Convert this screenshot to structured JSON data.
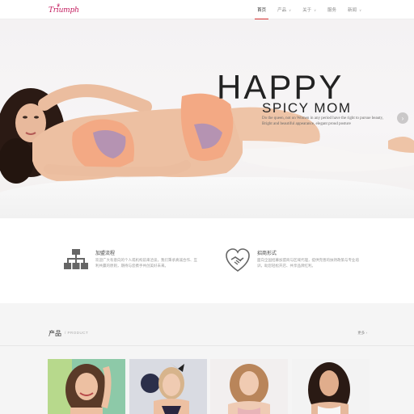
{
  "brand": {
    "logo_text": "Triumph"
  },
  "nav": {
    "items": [
      {
        "label": "首页",
        "active": true,
        "dropdown": false
      },
      {
        "label": "产品",
        "active": false,
        "dropdown": true
      },
      {
        "label": "关于",
        "active": false,
        "dropdown": true
      },
      {
        "label": "服务",
        "active": false,
        "dropdown": false
      },
      {
        "label": "新闻",
        "active": false,
        "dropdown": true
      }
    ]
  },
  "hero": {
    "title": "HAPPY",
    "subtitle": "SPICY MOM",
    "desc_line1": "Do the queen, not on Women in any period have the right to pursue beauty,",
    "desc_line2": "Bright and beautiful appearance, elegant proud posture",
    "next_icon": "chevron-right-icon"
  },
  "features": [
    {
      "icon": "org-chart-icon",
      "title": "加盟流程",
      "text": "欢迎广大有意向的个人或机构前来洽谈，我们秉承真诚合作、互利共赢的原则，期待与您携手共创美好未来。"
    },
    {
      "icon": "handshake-icon",
      "title": "招商形式",
      "text": "面向全国招募加盟商与区域代理，提供完善的扶持政策与专业培训，助您轻松开店、共享品牌红利。"
    }
  ],
  "products": {
    "title": "产品",
    "subtitle": "/ PRODUCT",
    "more_label": "更多 ›"
  },
  "colors": {
    "accent": "#d32f2f",
    "brand": "#c2185b"
  }
}
